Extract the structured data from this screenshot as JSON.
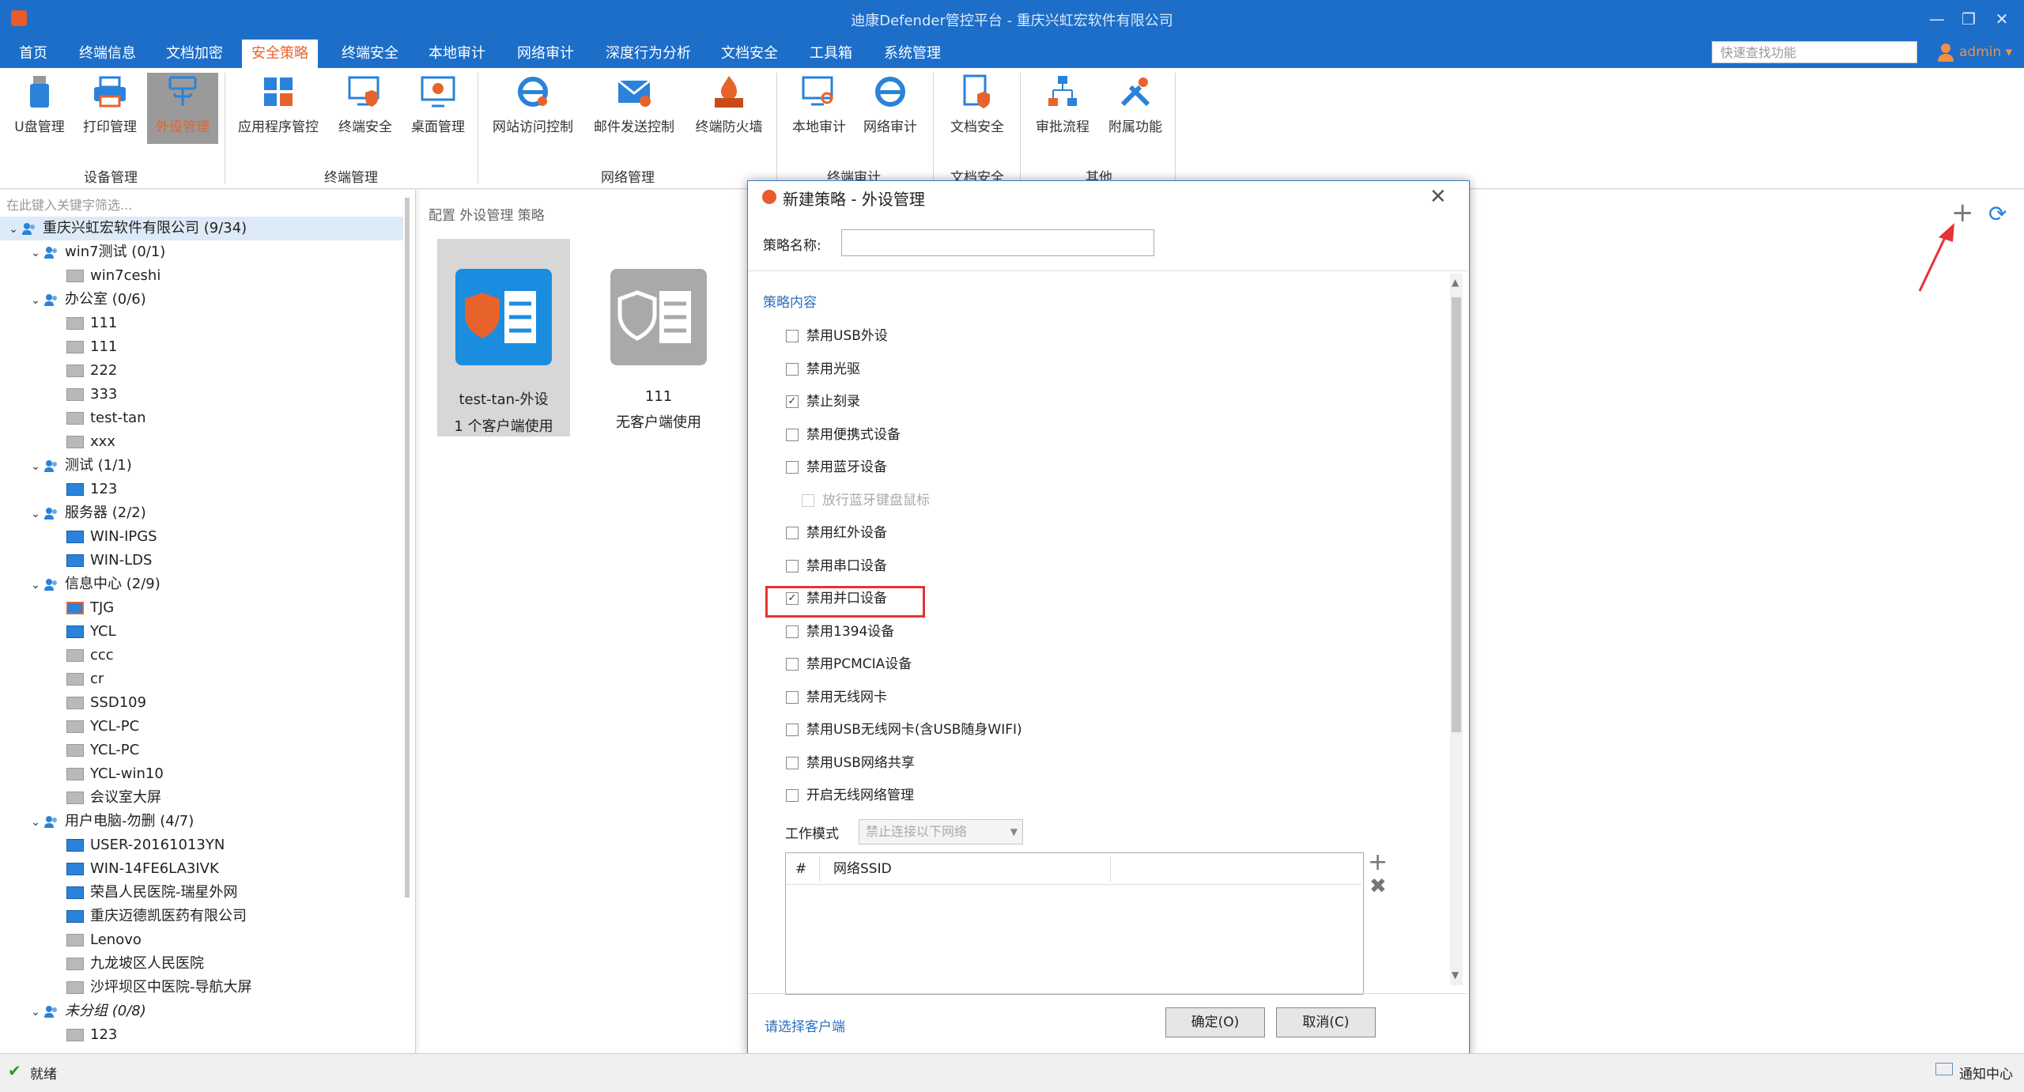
{
  "window": {
    "title": "迪康Defender管控平台 - 重庆兴虹宏软件有限公司",
    "controls": [
      "—",
      "❐",
      "✕"
    ]
  },
  "menu": {
    "items": [
      "首页",
      "终端信息",
      "文档加密",
      "安全策略",
      "终端安全",
      "本地审计",
      "网络审计",
      "深度行为分析",
      "文档安全",
      "工具箱",
      "系统管理"
    ],
    "active_index": 3
  },
  "quick_search": {
    "placeholder": "快速查找功能"
  },
  "user": {
    "name": "admin ▾"
  },
  "ribbon": {
    "buttons": [
      {
        "label": "U盘管理",
        "icon": "usb-drive-icon"
      },
      {
        "label": "打印管理",
        "icon": "printer-icon"
      },
      {
        "label": "外设管理",
        "icon": "usb-peripheral-icon"
      },
      {
        "label": "应用程序管控",
        "icon": "app-grid-icon"
      },
      {
        "label": "终端安全",
        "icon": "monitor-shield-icon"
      },
      {
        "label": "桌面管理",
        "icon": "desktop-gear-icon"
      },
      {
        "label": "网站访问控制",
        "icon": "ie-browser-icon"
      },
      {
        "label": "邮件发送控制",
        "icon": "mail-icon"
      },
      {
        "label": "终端防火墙",
        "icon": "firewall-icon"
      },
      {
        "label": "本地审计",
        "icon": "monitor-search-icon"
      },
      {
        "label": "网络审计",
        "icon": "ie-audit-icon"
      },
      {
        "label": "文档安全",
        "icon": "document-shield-icon"
      },
      {
        "label": "审批流程",
        "icon": "flow-icon"
      },
      {
        "label": "附属功能",
        "icon": "tools-icon"
      }
    ],
    "groups": [
      "设备管理",
      "终端管理",
      "网络管理",
      "终端审计",
      "文档安全",
      "其他"
    ]
  },
  "tree": {
    "filter_placeholder": "在此键入关键字筛选...",
    "rows": [
      {
        "label": "重庆兴虹宏软件有限公司 (9/34)",
        "level": 0,
        "type": "group",
        "expanded": true
      },
      {
        "label": "win7测试 (0/1)",
        "level": 1,
        "type": "group",
        "expanded": true
      },
      {
        "label": "win7ceshi",
        "level": 2,
        "type": "client",
        "state": "off"
      },
      {
        "label": "办公室 (0/6)",
        "level": 1,
        "type": "group",
        "expanded": true
      },
      {
        "label": "111",
        "level": 2,
        "type": "client",
        "state": "off"
      },
      {
        "label": "111",
        "level": 2,
        "type": "client",
        "state": "off"
      },
      {
        "label": "222",
        "level": 2,
        "type": "client",
        "state": "off"
      },
      {
        "label": "333",
        "level": 2,
        "type": "client",
        "state": "off"
      },
      {
        "label": "test-tan",
        "level": 2,
        "type": "client",
        "state": "off"
      },
      {
        "label": "xxx",
        "level": 2,
        "type": "client",
        "state": "off"
      },
      {
        "label": "测试 (1/1)",
        "level": 1,
        "type": "group",
        "expanded": true
      },
      {
        "label": "123",
        "level": 2,
        "type": "client",
        "state": "on"
      },
      {
        "label": "服务器 (2/2)",
        "level": 1,
        "type": "group",
        "expanded": true
      },
      {
        "label": "WIN-IPGS",
        "level": 2,
        "type": "client",
        "state": "on"
      },
      {
        "label": "WIN-LDS",
        "level": 2,
        "type": "client",
        "state": "on"
      },
      {
        "label": "信息中心 (2/9)",
        "level": 1,
        "type": "group",
        "expanded": true
      },
      {
        "label": "TJG",
        "level": 2,
        "type": "client",
        "state": "warn"
      },
      {
        "label": "YCL",
        "level": 2,
        "type": "client",
        "state": "on"
      },
      {
        "label": "ccc",
        "level": 2,
        "type": "client",
        "state": "off"
      },
      {
        "label": "cr",
        "level": 2,
        "type": "client",
        "state": "off"
      },
      {
        "label": "SSD109",
        "level": 2,
        "type": "client",
        "state": "off"
      },
      {
        "label": "YCL-PC",
        "level": 2,
        "type": "client",
        "state": "off"
      },
      {
        "label": "YCL-PC",
        "level": 2,
        "type": "client",
        "state": "off"
      },
      {
        "label": "YCL-win10",
        "level": 2,
        "type": "client",
        "state": "off"
      },
      {
        "label": "会议室大屏",
        "level": 2,
        "type": "client",
        "state": "off"
      },
      {
        "label": "用户电脑-勿删 (4/7)",
        "level": 1,
        "type": "group",
        "expanded": true
      },
      {
        "label": "USER-20161013YN",
        "level": 2,
        "type": "client",
        "state": "on"
      },
      {
        "label": "WIN-14FE6LA3IVK",
        "level": 2,
        "type": "client",
        "state": "on"
      },
      {
        "label": "荣昌人民医院-瑞星外网",
        "level": 2,
        "type": "client",
        "state": "on"
      },
      {
        "label": "重庆迈德凯医药有限公司",
        "level": 2,
        "type": "client",
        "state": "on"
      },
      {
        "label": "Lenovo",
        "level": 2,
        "type": "client",
        "state": "off"
      },
      {
        "label": "九龙坡区人民医院",
        "level": 2,
        "type": "client",
        "state": "off"
      },
      {
        "label": "沙坪坝区中医院-导航大屏",
        "level": 2,
        "type": "client",
        "state": "off"
      },
      {
        "label": "未分组 (0/8)",
        "level": 1,
        "type": "group",
        "expanded": true,
        "italic": true
      },
      {
        "label": "123",
        "level": 2,
        "type": "client",
        "state": "off"
      }
    ]
  },
  "main": {
    "breadcrumb": "配置 外设管理 策略",
    "cards": [
      {
        "name": "test-tan-外设",
        "usage": "1 个客户端使用",
        "selected": true
      },
      {
        "name": "111",
        "usage": "无客户端使用",
        "selected": false
      }
    ]
  },
  "dialog": {
    "title": "新建策略 - 外设管理",
    "name_label": "策略名称:",
    "name_value": "",
    "section_title": "策略内容",
    "options": [
      {
        "label": "禁用USB外设",
        "checked": false,
        "disabled": false,
        "indent": false
      },
      {
        "label": "禁用光驱",
        "checked": false,
        "disabled": false,
        "indent": false
      },
      {
        "label": "禁止刻录",
        "checked": true,
        "disabled": false,
        "indent": false
      },
      {
        "label": "禁用便携式设备",
        "checked": false,
        "disabled": false,
        "indent": false
      },
      {
        "label": "禁用蓝牙设备",
        "checked": false,
        "disabled": false,
        "indent": false
      },
      {
        "label": "放行蓝牙键盘鼠标",
        "checked": false,
        "disabled": true,
        "indent": true
      },
      {
        "label": "禁用红外设备",
        "checked": false,
        "disabled": false,
        "indent": false
      },
      {
        "label": "禁用串口设备",
        "checked": false,
        "disabled": false,
        "indent": false
      },
      {
        "label": "禁用并口设备",
        "checked": true,
        "disabled": false,
        "indent": false
      },
      {
        "label": "禁用1394设备",
        "checked": false,
        "disabled": false,
        "indent": false
      },
      {
        "label": "禁用PCMCIA设备",
        "checked": false,
        "disabled": false,
        "indent": false
      },
      {
        "label": "禁用无线网卡",
        "checked": false,
        "disabled": false,
        "indent": false
      },
      {
        "label": "禁用USB无线网卡(含USB随身WIFI)",
        "checked": false,
        "disabled": false,
        "indent": false
      },
      {
        "label": "禁用USB网络共享",
        "checked": false,
        "disabled": false,
        "indent": false
      },
      {
        "label": "开启无线网络管理",
        "checked": false,
        "disabled": false,
        "indent": false
      }
    ],
    "work_mode_label": "工作模式",
    "work_mode_value": "禁止连接以下网络",
    "ssid_table": {
      "col_index": "#",
      "col_ssid": "网络SSID"
    },
    "select_clients_link": "请选择客户端",
    "ok_label": "确定(O)",
    "cancel_label": "取消(C)"
  },
  "status": {
    "text": "就绪",
    "notice": "通知中心"
  },
  "colors": {
    "accent": "#1c6ec9",
    "brand_orange": "#e8632b",
    "annotation_red": "#e53333"
  }
}
